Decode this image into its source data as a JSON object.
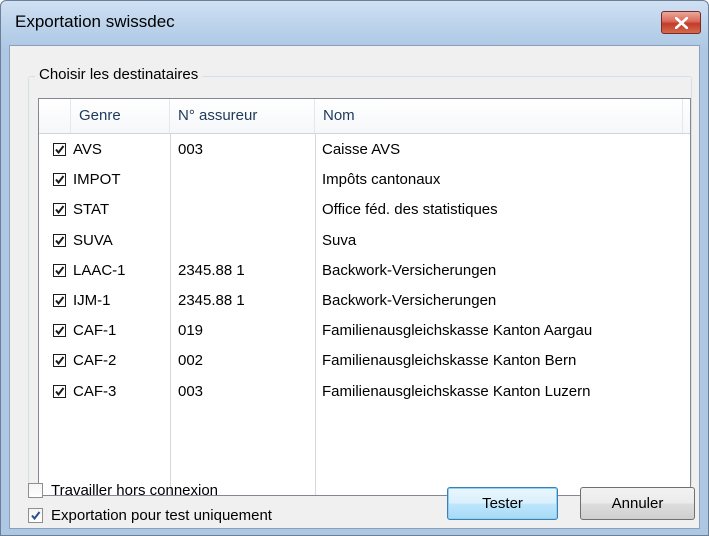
{
  "window": {
    "title": "Exportation swissdec",
    "close_icon": "close-icon"
  },
  "group": {
    "label": "Choisir les destinataires"
  },
  "columns": {
    "genre": "Genre",
    "insurer": "N° assureur",
    "name": "Nom"
  },
  "rows": [
    {
      "checked": true,
      "genre": "AVS",
      "insurer": "003",
      "name": "Caisse AVS"
    },
    {
      "checked": true,
      "genre": "IMPOT",
      "insurer": "",
      "name": "Impôts cantonaux"
    },
    {
      "checked": true,
      "genre": "STAT",
      "insurer": "",
      "name": "Office féd. des statistiques"
    },
    {
      "checked": true,
      "genre": "SUVA",
      "insurer": "",
      "name": "Suva"
    },
    {
      "checked": true,
      "genre": "LAAC-1",
      "insurer": "2345.88 1",
      "name": "Backwork-Versicherungen"
    },
    {
      "checked": true,
      "genre": "IJM-1",
      "insurer": "2345.88 1",
      "name": "Backwork-Versicherungen"
    },
    {
      "checked": true,
      "genre": "CAF-1",
      "insurer": "019",
      "name": "Familienausgleichskasse Kanton Aargau"
    },
    {
      "checked": true,
      "genre": "CAF-2",
      "insurer": "002",
      "name": "Familienausgleichskasse Kanton Bern"
    },
    {
      "checked": true,
      "genre": "CAF-3",
      "insurer": "003",
      "name": "Familienausgleichskasse Kanton Luzern"
    }
  ],
  "options": {
    "offline": {
      "label": "Travailler hors connexion",
      "checked": false
    },
    "test_only": {
      "label": "Exportation pour test uniquement",
      "checked": true
    }
  },
  "buttons": {
    "test": "Tester",
    "cancel": "Annuler"
  }
}
